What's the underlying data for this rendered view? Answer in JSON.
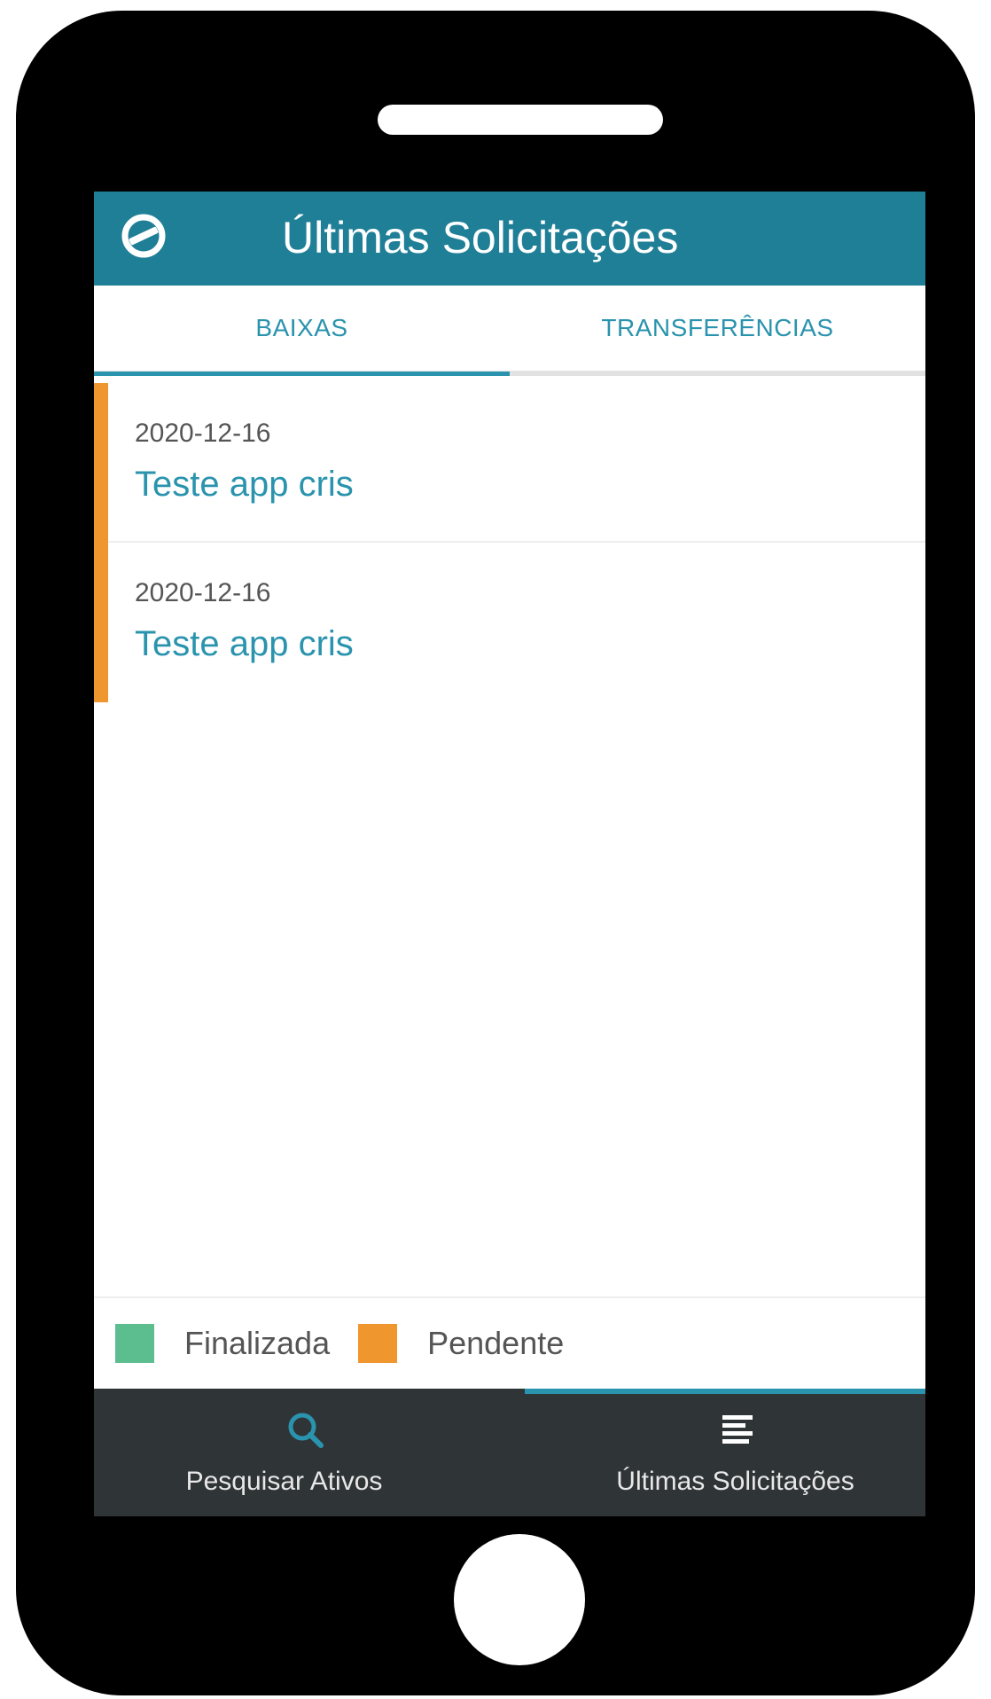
{
  "header": {
    "title": "Últimas Solicitações",
    "logo_icon": "totvs-logo-icon"
  },
  "tabs": [
    {
      "label": "BAIXAS",
      "active": true
    },
    {
      "label": "TRANSFERÊNCIAS",
      "active": false
    }
  ],
  "items": [
    {
      "date": "2020-12-16",
      "title": "Teste app cris",
      "status": "Pendente"
    },
    {
      "date": "2020-12-16",
      "title": "Teste app cris",
      "status": "Pendente"
    }
  ],
  "legend": [
    {
      "label": "Finalizada",
      "color": "#5cbd8f"
    },
    {
      "label": "Pendente",
      "color": "#f0962e"
    }
  ],
  "bottom_nav": [
    {
      "label": "Pesquisar Ativos",
      "icon": "search-icon",
      "active": false
    },
    {
      "label": "Últimas Solicitações",
      "icon": "list-icon",
      "active": true
    }
  ],
  "colors": {
    "header_bg": "#1f7f97",
    "accent": "#2a93ad",
    "pending": "#f0962e",
    "finalized": "#5cbd8f",
    "nav_bg": "#2f3437"
  }
}
